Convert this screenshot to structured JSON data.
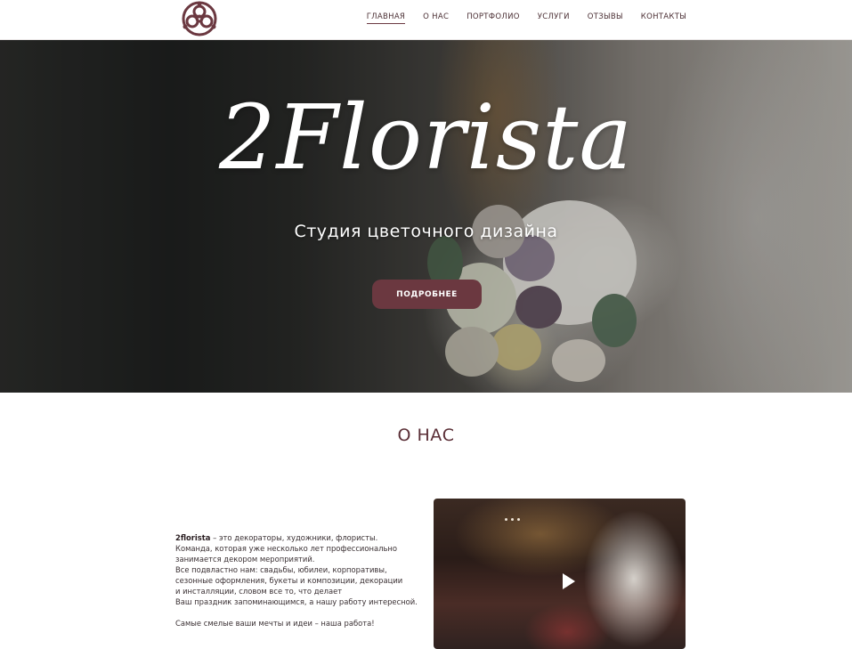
{
  "header": {
    "logo_icon": "floral-ornament-icon",
    "nav": [
      {
        "label": "ГЛАВНАЯ",
        "active": true
      },
      {
        "label": "О НАС",
        "active": false
      },
      {
        "label": "ПОРТФОЛИО",
        "active": false
      },
      {
        "label": "УСЛУГИ",
        "active": false
      },
      {
        "label": "ОТЗЫВЫ",
        "active": false
      },
      {
        "label": "КОНТАКТЫ",
        "active": false
      }
    ]
  },
  "hero": {
    "title": "2Florista",
    "subtitle": "Студия цветочного дизайна",
    "button_label": "ПОДРОБНЕЕ"
  },
  "about": {
    "title": "О НАС",
    "brand": "2florista",
    "line1_rest": " – это декораторы, художники, флористы.",
    "line2": "Команда, которая уже несколько лет профессионально",
    "line3": "занимается декором мероприятий.",
    "line4": "Все подвластно нам: свадьбы, юбилеи, корпоративы,",
    "line5": "сезонные оформления, букеты и композиции, декорации",
    "line6": "и инсталляции, словом все то, что делает",
    "line7": "Ваш праздник запоминающимся, а нашу работу интересной.",
    "line8": "Самые смелые ваши мечты и идеи – наша работа!",
    "video_icon": "play-icon"
  },
  "colors": {
    "accent": "#6b3840",
    "heading": "#5a2e36"
  }
}
